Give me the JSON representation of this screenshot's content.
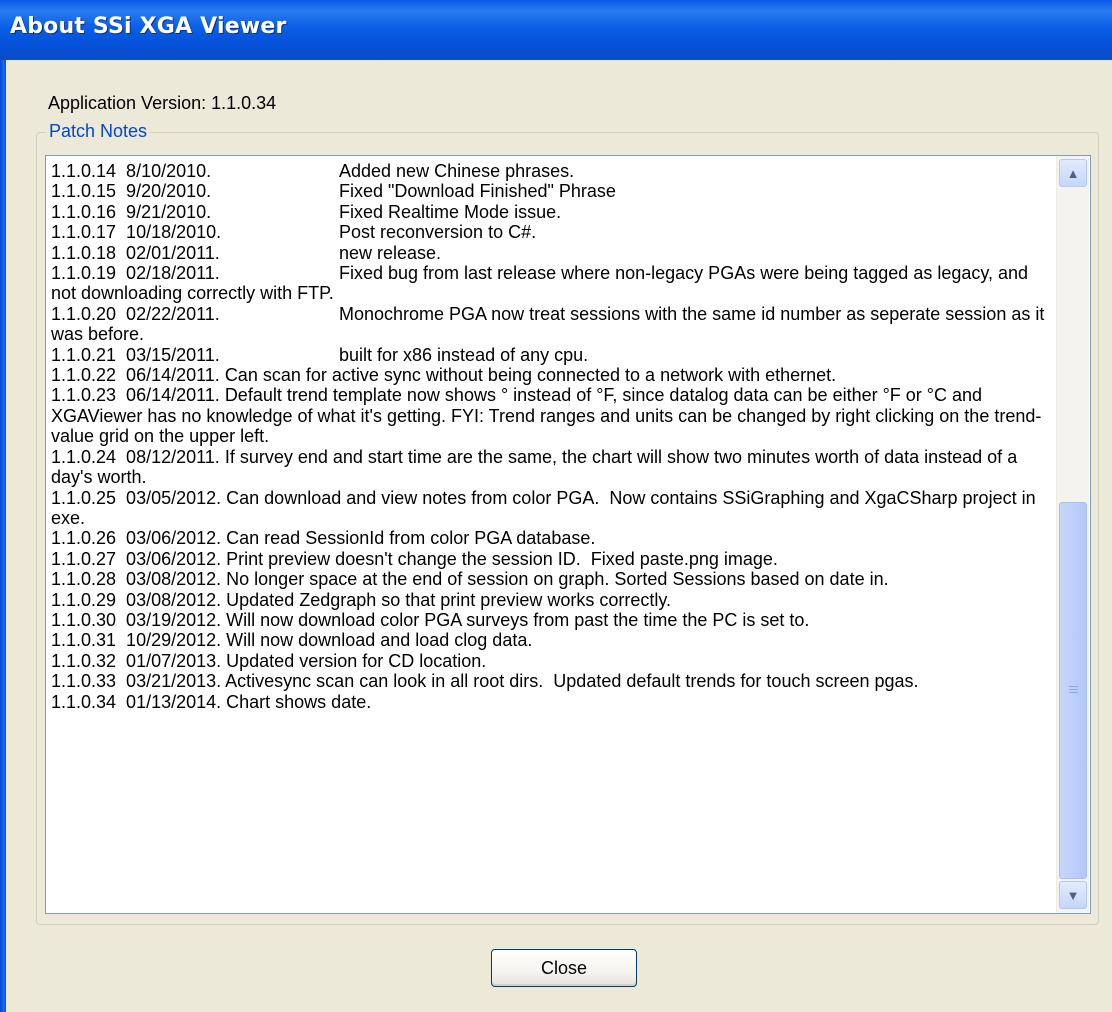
{
  "window": {
    "title": "About SSi XGA Viewer"
  },
  "version_label": "Application Version: 1.1.0.34",
  "patch_notes": {
    "legend": "Patch Notes",
    "lines": [
      "1.1.0.14  8/10/2010.\t\t\tAdded new Chinese phrases.",
      "1.1.0.15  9/20/2010.\t\t\tFixed \"Download Finished\" Phrase",
      "1.1.0.16  9/21/2010.\t\t\tFixed Realtime Mode issue.",
      "1.1.0.17  10/18/2010.\t\t\tPost reconversion to C#.",
      "1.1.0.18  02/01/2011.\t\t\tnew release.",
      "1.1.0.19  02/18/2011.\t\t\tFixed bug from last release where non-legacy PGAs were being tagged as legacy, and not downloading correctly with FTP.",
      "1.1.0.20  02/22/2011.\t\t\tMonochrome PGA now treat sessions with the same id number as seperate session as it was before.",
      "1.1.0.21  03/15/2011.\t\t\tbuilt for x86 instead of any cpu.",
      "1.1.0.22  06/14/2011. Can scan for active sync without being connected to a network with ethernet.",
      "1.1.0.23  06/14/2011. Default trend template now shows ° instead of °F, since datalog data can be either °F or °C and XGAViewer has no knowledge of what it's getting. FYI: Trend ranges and units can be changed by right clicking on the trend-value grid on the upper left.",
      "1.1.0.24  08/12/2011. If survey end and start time are the same, the chart will show two minutes worth of data instead of a day's worth.",
      "1.1.0.25  03/05/2012. Can download and view notes from color PGA.  Now contains SSiGraphing and XgaCSharp project in exe.",
      "1.1.0.26  03/06/2012. Can read SessionId from color PGA database.",
      "1.1.0.27  03/06/2012. Print preview doesn't change the session ID.  Fixed paste.png image.",
      "1.1.0.28  03/08/2012. No longer space at the end of session on graph. Sorted Sessions based on date in.",
      "1.1.0.29  03/08/2012. Updated Zedgraph so that print preview works correctly.",
      "1.1.0.30  03/19/2012. Will now download color PGA surveys from past the time the PC is set to.",
      "1.1.0.31  10/29/2012. Will now download and load clog data.",
      "1.1.0.32  01/07/2013. Updated version for CD location.",
      "1.1.0.33  03/21/2013. Activesync scan can look in all root dirs.  Updated default trends for touch screen pgas.",
      "1.1.0.34  01/13/2014. Chart shows date."
    ]
  },
  "close_label": "Close",
  "icons": {
    "scroll_up": "scroll-up-arrow-icon",
    "scroll_down": "scroll-down-arrow-icon",
    "grip": "scrollbar-grip-icon"
  },
  "colors": {
    "titlebar": "#0450d8",
    "legend_text": "#0046d5",
    "dialog_bg": "#ece9d8"
  }
}
